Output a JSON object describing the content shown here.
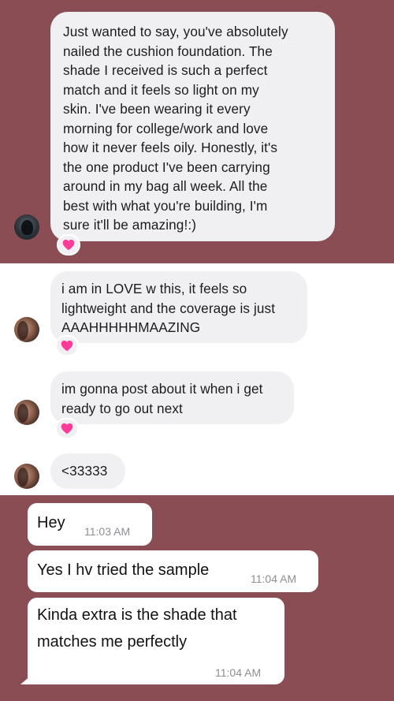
{
  "incoming_messages": [
    {
      "id": "m1",
      "text": "Just wanted to say, you've absolutely\nnailed the cushion foundation. The\nshade I received is such a perfect\nmatch and it feels so light on my\nskin. I've been wearing it every\nmorning for college/work and love\nhow it never feels oily. Honestly, it's\nthe one product I've been carrying\naround in my bag all week. All the\nbest with what you're building, I'm\nsure it'll be amazing!:)",
      "reaction": "heart"
    },
    {
      "id": "m2",
      "text": "i am in LOVE w this, it feels so\nlightweight and the coverage is just\nAAAHHHHHMAAZING",
      "reaction": "heart"
    },
    {
      "id": "m3",
      "text": "im gonna post about it when i get\nready to go out next",
      "reaction": "heart"
    },
    {
      "id": "m4",
      "text": "<33333"
    }
  ],
  "outgoing_messages": [
    {
      "id": "o1",
      "text": "Hey",
      "time": "11:03 AM"
    },
    {
      "id": "o2",
      "text": "Yes I hv tried the sample",
      "time": "11:04 AM"
    },
    {
      "id": "o3",
      "text": "Kinda extra is the shade that\nmatches me perfectly",
      "time": "11:04 AM"
    }
  ],
  "colors": {
    "panel_bg": "#8a4d53",
    "incoming_bubble": "#f0f0f2",
    "outgoing_bubble": "#ffffff",
    "heart": "#ff3b9a"
  },
  "icons": {
    "reaction": "heart-icon",
    "avatar": "profile-avatar"
  }
}
